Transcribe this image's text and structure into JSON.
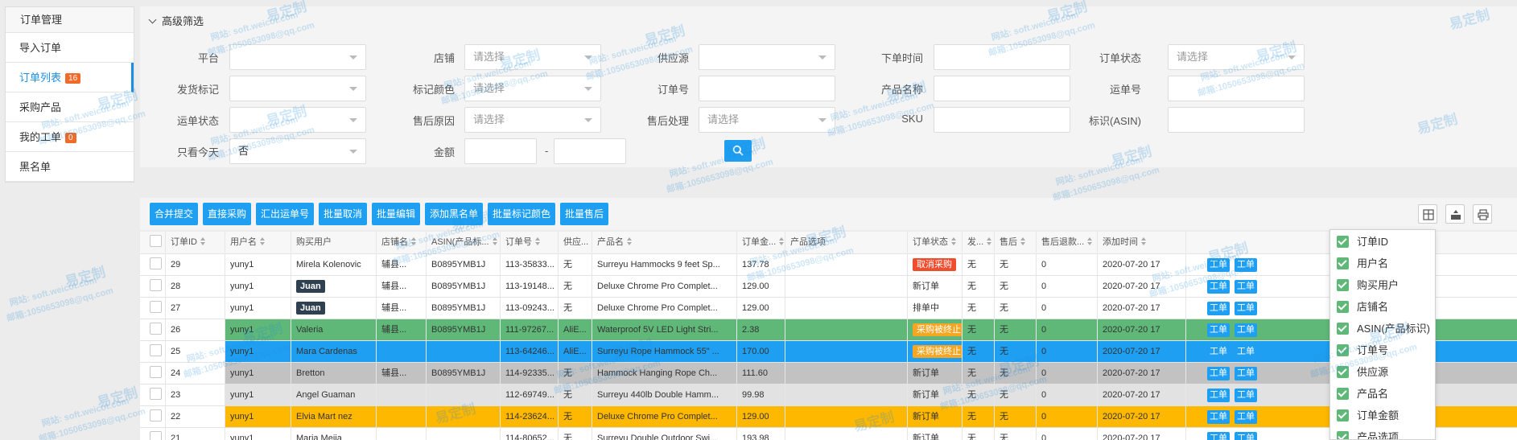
{
  "sidebar": {
    "header": "订单管理",
    "items": [
      {
        "label": "导入订单",
        "badge": ""
      },
      {
        "label": "订单列表",
        "badge": "16"
      },
      {
        "label": "采购产品",
        "badge": ""
      },
      {
        "label": "我的工单",
        "badge": "0"
      },
      {
        "label": "黑名单",
        "badge": ""
      }
    ]
  },
  "filter": {
    "title": "高级筛选",
    "fields": {
      "platform": {
        "label": "平台",
        "value": ""
      },
      "shop": {
        "label": "店铺",
        "value": "请选择"
      },
      "supplier": {
        "label": "供应源",
        "value": ""
      },
      "order_time": {
        "label": "下单时间",
        "value": ""
      },
      "order_status": {
        "label": "订单状态",
        "value": "请选择"
      },
      "ship_mark": {
        "label": "发货标记",
        "value": ""
      },
      "mark_color": {
        "label": "标记颜色",
        "value": "请选择"
      },
      "order_no": {
        "label": "订单号",
        "value": ""
      },
      "product_name": {
        "label": "产品名称",
        "value": ""
      },
      "tracking_no": {
        "label": "运单号",
        "value": ""
      },
      "shipping_status": {
        "label": "运单状态",
        "value": ""
      },
      "after_sale_reason": {
        "label": "售后原因",
        "value": "请选择"
      },
      "after_sale_handle": {
        "label": "售后处理",
        "value": "请选择"
      },
      "sku": {
        "label": "SKU",
        "value": ""
      },
      "asin": {
        "label": "标识(ASIN)",
        "value": ""
      },
      "today_only": {
        "label": "只看今天",
        "value": "否"
      },
      "amount": {
        "label": "金额",
        "min": "",
        "max": "",
        "separator": "-"
      }
    }
  },
  "toolbar": {
    "buttons": [
      "合并提交",
      "直接采购",
      "汇出运单号",
      "批量取消",
      "批量编辑",
      "添加黑名单",
      "批量标记颜色",
      "批量售后"
    ]
  },
  "table": {
    "headers": [
      "订单ID",
      "用户名",
      "购买用户",
      "店铺名",
      "ASIN(产品标...",
      "订单号",
      "供应...",
      "产品名",
      "订单金...",
      "产品选项",
      "订单状态",
      "发...",
      "售后",
      "售后退款...",
      "添加时间"
    ],
    "op_label": "工单",
    "rows": [
      {
        "id": "29",
        "user": "yuny1",
        "buyer": "Mirela Kolenovic",
        "buyer_tag": false,
        "shop": "辅县...",
        "asin": "B0895YMB1J",
        "order_no": "113-35833...",
        "supplier": "无",
        "product": "Surreyu Hammocks 9 feet Sp...",
        "amount": "137.78",
        "status": "取消采购",
        "status_style": "red",
        "ship": "无",
        "after": "无",
        "refund": "0",
        "time": "2020-07-20 17",
        "bg": "#ffffff"
      },
      {
        "id": "28",
        "user": "yuny1",
        "buyer": "Juan",
        "buyer_tag": true,
        "shop": "辅县...",
        "asin": "B0895YMB1J",
        "order_no": "113-19148...",
        "supplier": "无",
        "product": "Deluxe Chrome Pro Complet...",
        "amount": "129.00",
        "status": "新订单",
        "status_style": "",
        "ship": "无",
        "after": "无",
        "refund": "0",
        "time": "2020-07-20 17",
        "bg": "#ffffff"
      },
      {
        "id": "27",
        "user": "yuny1",
        "buyer": "Juan",
        "buyer_tag": true,
        "shop": "辅县...",
        "asin": "B0895YMB1J",
        "order_no": "113-09243...",
        "supplier": "无",
        "product": "Deluxe Chrome Pro Complet...",
        "amount": "129.00",
        "status": "排单中",
        "status_style": "",
        "ship": "无",
        "after": "无",
        "refund": "0",
        "time": "2020-07-20 17",
        "bg": "#ffffff"
      },
      {
        "id": "26",
        "user": "yuny1",
        "buyer": "Valeria",
        "buyer_tag": false,
        "shop": "辅县...",
        "asin": "B0895YMB1J",
        "order_no": "111-97267...",
        "supplier": "AliE...",
        "product": "Waterproof 5V LED Light Stri...",
        "amount": "2.38",
        "status": "采购被终止",
        "status_style": "orange",
        "ship": "无",
        "after": "无",
        "refund": "0",
        "time": "2020-07-20 17",
        "bg": "#5fb878"
      },
      {
        "id": "25",
        "user": "yuny1",
        "buyer": "Mara Cardenas",
        "buyer_tag": false,
        "shop": "",
        "asin": "",
        "order_no": "113-64246...",
        "supplier": "AliE...",
        "product": "Surreyu Rope Hammock 55\" ...",
        "amount": "170.00",
        "status": "采购被终止",
        "status_style": "orange",
        "ship": "无",
        "after": "无",
        "refund": "0",
        "time": "2020-07-20 17",
        "bg": "#1e9ff2"
      },
      {
        "id": "24",
        "user": "yuny1",
        "buyer": "Bretton",
        "buyer_tag": false,
        "shop": "辅县...",
        "asin": "B0895YMB1J",
        "order_no": "114-92335...",
        "supplier": "无",
        "product": "Hammock Hanging Rope Ch...",
        "amount": "111.60",
        "status": "新订单",
        "status_style": "",
        "ship": "无",
        "after": "无",
        "refund": "0",
        "time": "2020-07-20 17",
        "bg": "#c2c2c2"
      },
      {
        "id": "23",
        "user": "yuny1",
        "buyer": "Angel Guaman",
        "buyer_tag": false,
        "shop": "",
        "asin": "",
        "order_no": "112-69749...",
        "supplier": "无",
        "product": "Surreyu 440lb Double Hamm...",
        "amount": "99.98",
        "status": "新订单",
        "status_style": "",
        "ship": "无",
        "after": "无",
        "refund": "0",
        "time": "2020-07-20 17",
        "bg": "#e2e2e2"
      },
      {
        "id": "22",
        "user": "yuny1",
        "buyer": "Elvia Mart nez",
        "buyer_tag": false,
        "shop": "",
        "asin": "",
        "order_no": "114-23624...",
        "supplier": "无",
        "product": "Deluxe Chrome Pro Complet...",
        "amount": "129.00",
        "status": "新订单",
        "status_style": "",
        "ship": "无",
        "after": "无",
        "refund": "0",
        "time": "2020-07-20 17",
        "bg": "#ffb800"
      },
      {
        "id": "21",
        "user": "yuny1",
        "buyer": "Maria Mejia",
        "buyer_tag": false,
        "shop": "",
        "asin": "",
        "order_no": "114-80652...",
        "supplier": "无",
        "product": "Surreyu Double Outdoor Swi...",
        "amount": "193.98",
        "status": "新订单",
        "status_style": "",
        "ship": "无",
        "after": "无",
        "refund": "0",
        "time": "2020-07-20 17",
        "bg": "#ffffff"
      }
    ]
  },
  "column_popup": {
    "options": [
      "订单ID",
      "用户名",
      "购买用户",
      "店铺名",
      "ASIN(产品标识)",
      "订单号",
      "供应源",
      "产品名",
      "订单金额",
      "产品选项"
    ]
  },
  "watermark": {
    "brand": "易定制",
    "site": "网站: soft.weicot.com",
    "mail": "邮箱:1050653098@qq.com"
  },
  "colors": {
    "accent": "#1e9ff2",
    "badge": "#f26a2a",
    "green_row": "#5fb878",
    "blue_row": "#1e9ff2",
    "yellow_row": "#ffb800",
    "gray_row": "#c2c2c2"
  }
}
